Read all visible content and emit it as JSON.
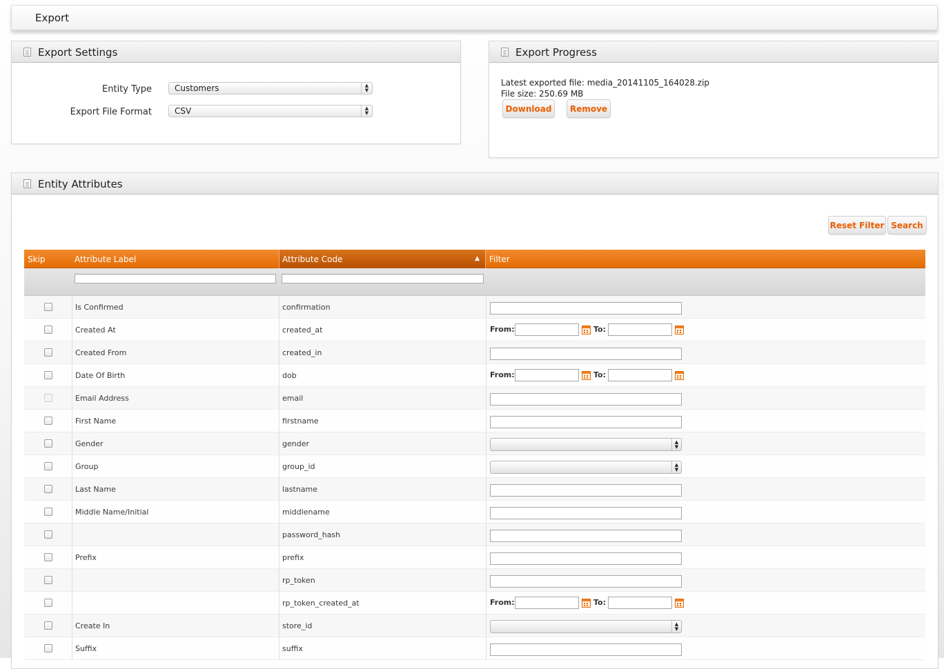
{
  "page": {
    "title": "Export"
  },
  "export_settings": {
    "title": "Export Settings",
    "entity_type_label": "Entity Type",
    "entity_type_value": "Customers",
    "format_label": "Export File Format",
    "format_value": "CSV"
  },
  "export_progress": {
    "title": "Export Progress",
    "latest_file": "Latest exported file: media_20141105_164028.zip",
    "file_size": "File size: 250.69 MB",
    "download_label": "Download",
    "remove_label": "Remove"
  },
  "entity_attributes": {
    "title": "Entity Attributes",
    "reset_filter_label": "Reset Filter",
    "search_label": "Search",
    "columns": {
      "skip": "Skip",
      "label": "Attribute Label",
      "code": "Attribute Code",
      "filter": "Filter"
    },
    "from_label": "From:",
    "to_label": "To:",
    "rows": [
      {
        "label": "Is Confirmed",
        "code": "confirmation",
        "filter": "text",
        "skip_disabled": false
      },
      {
        "label": "Created At",
        "code": "created_at",
        "filter": "date",
        "skip_disabled": false
      },
      {
        "label": "Created From",
        "code": "created_in",
        "filter": "text",
        "skip_disabled": false
      },
      {
        "label": "Date Of Birth",
        "code": "dob",
        "filter": "date",
        "skip_disabled": false
      },
      {
        "label": "Email Address",
        "code": "email",
        "filter": "text",
        "skip_disabled": true
      },
      {
        "label": "First Name",
        "code": "firstname",
        "filter": "text",
        "skip_disabled": false
      },
      {
        "label": "Gender",
        "code": "gender",
        "filter": "select",
        "skip_disabled": false
      },
      {
        "label": "Group",
        "code": "group_id",
        "filter": "select",
        "skip_disabled": false
      },
      {
        "label": "Last Name",
        "code": "lastname",
        "filter": "text",
        "skip_disabled": false
      },
      {
        "label": "Middle Name/Initial",
        "code": "middlename",
        "filter": "text",
        "skip_disabled": false
      },
      {
        "label": "",
        "code": "password_hash",
        "filter": "text",
        "skip_disabled": false
      },
      {
        "label": "Prefix",
        "code": "prefix",
        "filter": "text",
        "skip_disabled": false
      },
      {
        "label": "",
        "code": "rp_token",
        "filter": "text",
        "skip_disabled": false
      },
      {
        "label": "",
        "code": "rp_token_created_at",
        "filter": "date",
        "skip_disabled": false
      },
      {
        "label": "Create In",
        "code": "store_id",
        "filter": "select",
        "skip_disabled": false
      },
      {
        "label": "Suffix",
        "code": "suffix",
        "filter": "text",
        "skip_disabled": false
      }
    ]
  },
  "colors": {
    "accent": "#e56d03",
    "button_text": "#eb5e00"
  },
  "icons": {
    "panel": "document-icon",
    "calendar": "calendar-icon",
    "sort": "sort-asc-icon"
  }
}
